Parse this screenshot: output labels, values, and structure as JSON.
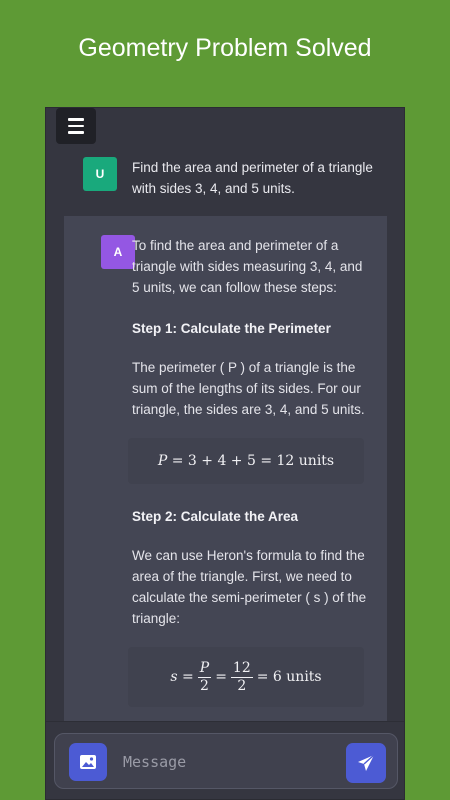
{
  "promo": {
    "title": "Geometry Problem Solved"
  },
  "user_message": {
    "avatar": "U",
    "text": "Find the area and perimeter of a triangle with sides 3, 4, and 5 units."
  },
  "ai_message": {
    "avatar": "A",
    "intro": "To find the area and perimeter of a triangle with sides measuring 3, 4, and 5 units, we can follow these steps:",
    "step1_heading": "Step 1: Calculate the Perimeter",
    "step1_text": "The perimeter ( P ) of a triangle is the sum of the lengths of its sides. For our triangle, the sides are 3, 4, and 5 units.",
    "step1_formula": {
      "lhs": "P",
      "rhs": "= 3 + 4 + 5 = 12 units"
    },
    "step2_heading": "Step 2: Calculate the Area",
    "step2_text": "We can use Heron's formula to find the area of the triangle. First, we need to calculate the semi-perimeter ( s ) of the triangle:",
    "step2_formula": {
      "lhs": "s =",
      "frac1_num": "P",
      "frac1_den": "2",
      "eq": "=",
      "frac2_num": "12",
      "frac2_den": "2",
      "rhs": "= 6 units"
    }
  },
  "composer": {
    "placeholder": "Message"
  },
  "icons": {
    "menu": "hamburger-menu-icon",
    "image": "image-icon",
    "send": "send-icon"
  },
  "colors": {
    "accent": "#4c5bd4",
    "user_avatar": "#19a97c",
    "ai_avatar": "#9457e3",
    "background": "#5e9a35"
  }
}
